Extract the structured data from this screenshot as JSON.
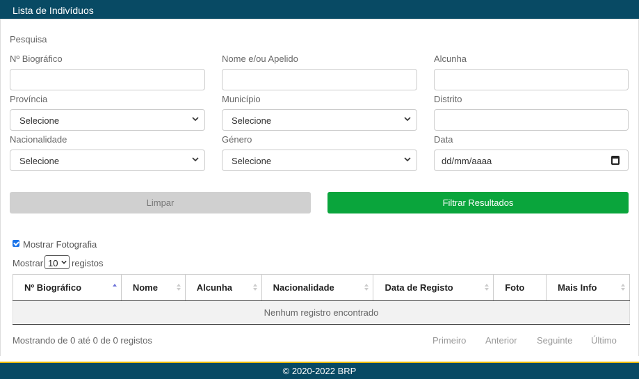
{
  "header": {
    "title": "Lista de Indivíduos"
  },
  "search": {
    "heading": "Pesquisa",
    "fields": {
      "nbio": {
        "label": "Nº Biográfico",
        "value": ""
      },
      "nome": {
        "label": "Nome e/ou Apelido",
        "value": ""
      },
      "alcunha": {
        "label": "Alcunha",
        "value": ""
      },
      "provincia": {
        "label": "Província",
        "value": "Selecione"
      },
      "municipio": {
        "label": "Município",
        "value": "Selecione"
      },
      "distrito": {
        "label": "Distrito",
        "value": ""
      },
      "nacionalidade": {
        "label": "Nacionalidade",
        "value": "Selecione"
      },
      "genero": {
        "label": "Género",
        "value": "Selecione"
      },
      "data": {
        "label": "Data",
        "value": "dd/mm/aaaa"
      }
    },
    "buttons": {
      "clear": "Limpar",
      "filter": "Filtrar Resultados"
    }
  },
  "options": {
    "show_photo_label": "Mostrar Fotografia",
    "show_photo_checked": true
  },
  "length": {
    "prefix": "Mostrar",
    "value": "10",
    "suffix": "registos"
  },
  "table": {
    "columns": [
      "Nº Biográfico",
      "Nome",
      "Alcunha",
      "Nacionalidade",
      "Data de Registo",
      "Foto",
      "Mais Info"
    ],
    "empty_message": "Nenhum registro encontrado"
  },
  "info": "Mostrando de 0 até 0 de 0 registos",
  "pagination": {
    "first": "Primeiro",
    "prev": "Anterior",
    "next": "Seguinte",
    "last": "Último"
  },
  "footer": {
    "text": "© 2020-2022 BRP"
  },
  "colors": {
    "header": "#084a64",
    "filter_button": "#0aa53c",
    "clear_button": "#d0d0d0",
    "footer_accent": "#e6b800"
  }
}
